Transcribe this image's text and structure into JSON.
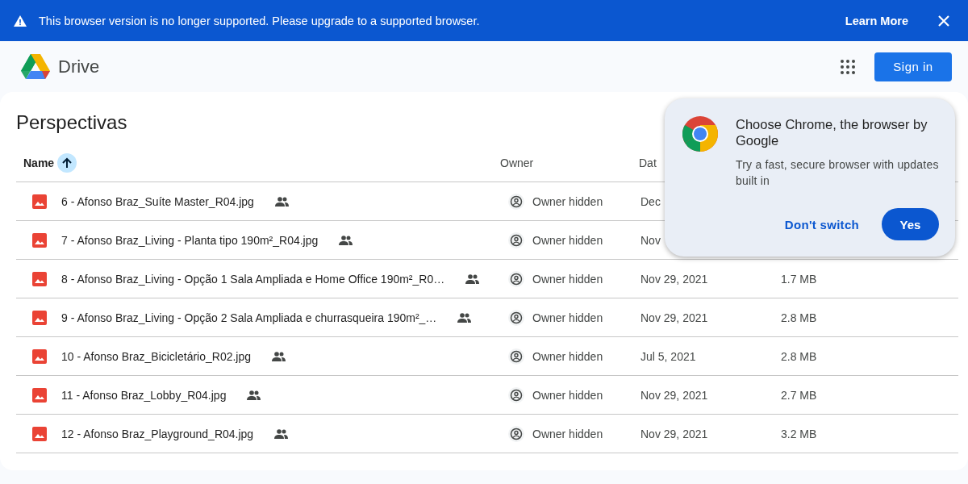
{
  "banner": {
    "message": "This browser version is no longer supported. Please upgrade to a supported browser.",
    "link": "Learn More"
  },
  "header": {
    "app_name": "Drive",
    "sign_in": "Sign in"
  },
  "folder": {
    "title": "Perspectivas",
    "columns": [
      {
        "label": "Name",
        "sorted": true
      },
      {
        "label": "Owner",
        "sorted": false
      },
      {
        "label": "Dat",
        "sorted": false
      }
    ],
    "rows": [
      {
        "name": "6 - Afonso Braz_Suíte Master_R04.jpg",
        "shared": true,
        "owner": "Owner hidden",
        "date": "Dec"
      },
      {
        "name": "7 - Afonso Braz_Living - Planta tipo 190m²_R04.jpg",
        "shared": true,
        "owner": "Owner hidden",
        "date": "Nov"
      },
      {
        "name": "8 - Afonso Braz_Living - Opção 1 Sala Ampliada e Home Office 190m²_R0…",
        "shared": true,
        "owner": "Owner hidden",
        "date": "Nov 29, 2021",
        "size": "1.7 MB"
      },
      {
        "name": "9 - Afonso Braz_Living - Opção 2 Sala Ampliada e churrasqueira 190m²_…",
        "shared": true,
        "owner": "Owner hidden",
        "date": "Nov 29, 2021",
        "size": "2.8 MB"
      },
      {
        "name": "10 - Afonso Braz_Bicicletário_R02.jpg",
        "shared": true,
        "owner": "Owner hidden",
        "date": "Jul 5, 2021",
        "size": "2.8 MB"
      },
      {
        "name": "11 - Afonso Braz_Lobby_R04.jpg",
        "shared": true,
        "owner": "Owner hidden",
        "date": "Nov 29, 2021",
        "size": "2.7 MB"
      },
      {
        "name": "12 - Afonso Braz_Playground_R04.jpg",
        "shared": true,
        "owner": "Owner hidden",
        "date": "Nov 29, 2021",
        "size": "3.2 MB"
      }
    ]
  },
  "promo": {
    "title": "Choose Chrome, the browser by Google",
    "text": "Try a fast, secure browser with updates built in",
    "secondary": "Don't switch",
    "primary": "Yes"
  }
}
